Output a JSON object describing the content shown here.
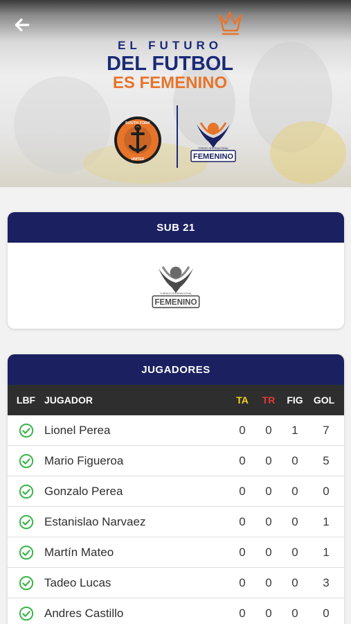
{
  "hero": {
    "line1": "EL FUTURO",
    "line2": "DEL FUTBOL",
    "line3": "ES FEMENINO",
    "team_logo_text_top": "SOUTH FORK",
    "team_logo_text_bottom": "UNITED",
    "tournament_logo_text": "FEMENINO",
    "tournament_logo_subtext": "TORNEO INTERNACIONAL"
  },
  "category": {
    "title": "SUB 21",
    "logo_text": "FEMENINO",
    "logo_subtext": "TORNEO INTERNACIONAL"
  },
  "players": {
    "title": "JUGADORES",
    "columns": {
      "lbf": "LBF",
      "name": "JUGADOR",
      "ta": "TA",
      "tr": "TR",
      "fig": "FIG",
      "gol": "GOL"
    },
    "rows": [
      {
        "name": "Lionel Perea",
        "ta": "0",
        "tr": "0",
        "fig": "1",
        "gol": "7"
      },
      {
        "name": "Mario Figueroa",
        "ta": "0",
        "tr": "0",
        "fig": "0",
        "gol": "5"
      },
      {
        "name": "Gonzalo Perea",
        "ta": "0",
        "tr": "0",
        "fig": "0",
        "gol": "0"
      },
      {
        "name": "Estanislao Narvaez",
        "ta": "0",
        "tr": "0",
        "fig": "0",
        "gol": "1"
      },
      {
        "name": "Martín Mateo",
        "ta": "0",
        "tr": "0",
        "fig": "0",
        "gol": "1"
      },
      {
        "name": "Tadeo Lucas",
        "ta": "0",
        "tr": "0",
        "fig": "0",
        "gol": "3"
      },
      {
        "name": "Andres Castillo",
        "ta": "0",
        "tr": "0",
        "fig": "0",
        "gol": "0"
      }
    ]
  },
  "icons": {
    "back": "arrow-left-icon",
    "check": "check-circle-icon",
    "crown": "crown-icon"
  },
  "colors": {
    "navy": "#1b2160",
    "title_navy": "#1a2a78",
    "orange": "#e8742a",
    "ta_yellow": "#f3d41c",
    "tr_red": "#e53935",
    "check_green": "#3bb54a",
    "table_header": "#2e2e2e"
  }
}
